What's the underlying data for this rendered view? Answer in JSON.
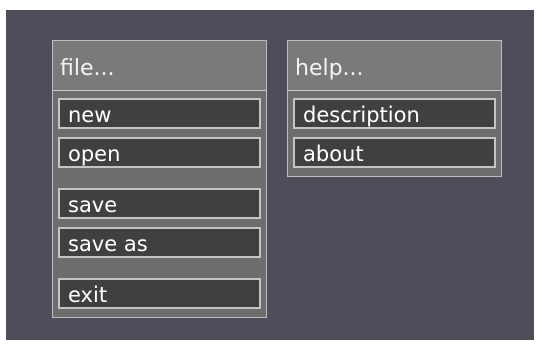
{
  "file_menu": {
    "title": "file...",
    "items": [
      {
        "label": "new"
      },
      {
        "label": "open"
      },
      {
        "label": "save"
      },
      {
        "label": "save as"
      },
      {
        "label": "exit"
      }
    ]
  },
  "help_menu": {
    "title": "help...",
    "items": [
      {
        "label": "description"
      },
      {
        "label": "about"
      }
    ]
  },
  "colors": {
    "background": "#4e4e5a",
    "panel": "#6d6d6d",
    "header": "#7a7a7a",
    "button": "#404040",
    "border": "#c4c4c4",
    "text": "#ffffff"
  }
}
